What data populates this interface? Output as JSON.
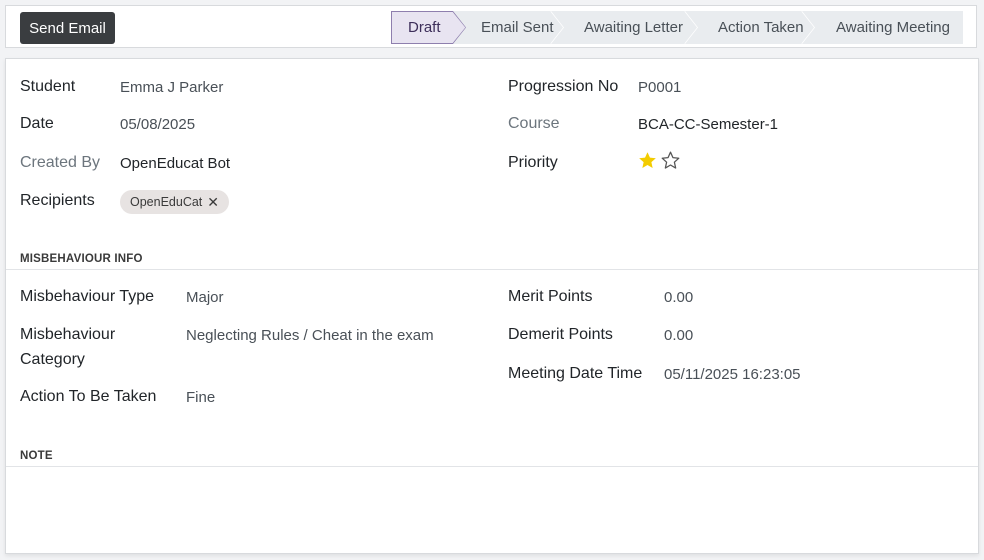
{
  "toolbar": {
    "send_email_label": "Send Email"
  },
  "statusbar": {
    "stages": [
      {
        "label": "Draft",
        "active": true
      },
      {
        "label": "Email Sent",
        "active": false
      },
      {
        "label": "Awaiting Letter",
        "active": false
      },
      {
        "label": "Action Taken",
        "active": false
      },
      {
        "label": "Awaiting Meeting",
        "active": false
      }
    ]
  },
  "form": {
    "student": {
      "label": "Student",
      "value": "Emma J Parker"
    },
    "date": {
      "label": "Date",
      "value": "05/08/2025"
    },
    "created_by": {
      "label": "Created By",
      "value": "OpenEducat Bot"
    },
    "recipients": {
      "label": "Recipients",
      "tags": [
        "OpenEduCat"
      ]
    },
    "progression_no": {
      "label": "Progression No",
      "value": "P0001"
    },
    "course": {
      "label": "Course",
      "value": "BCA-CC-Semester-1"
    },
    "priority": {
      "label": "Priority",
      "stars_filled": 1,
      "stars_total": 2
    },
    "misbehaviour_section": "MISBEHAVIOUR INFO",
    "misbehaviour_type": {
      "label": "Misbehaviour Type",
      "value": "Major"
    },
    "misbehaviour_category": {
      "label_line1": "Misbehaviour",
      "label_line2": "Category",
      "value": "Neglecting Rules / Cheat in the exam"
    },
    "action_to_be_taken": {
      "label": "Action To Be Taken",
      "value": "Fine"
    },
    "merit_points": {
      "label": "Merit Points",
      "value": "0.00"
    },
    "demerit_points": {
      "label": "Demerit Points",
      "value": "0.00"
    },
    "meeting_date_time": {
      "label": "Meeting Date Time",
      "value": "05/11/2025 16:23:05"
    },
    "note_section": "NOTE"
  },
  "colors": {
    "primary_button": "#3a3d40",
    "active_stage_bg": "#e8e4f1",
    "active_stage_border": "#8e7fae",
    "inactive_stage_bg": "#e9ecef",
    "star_filled": "#f3cc00"
  }
}
